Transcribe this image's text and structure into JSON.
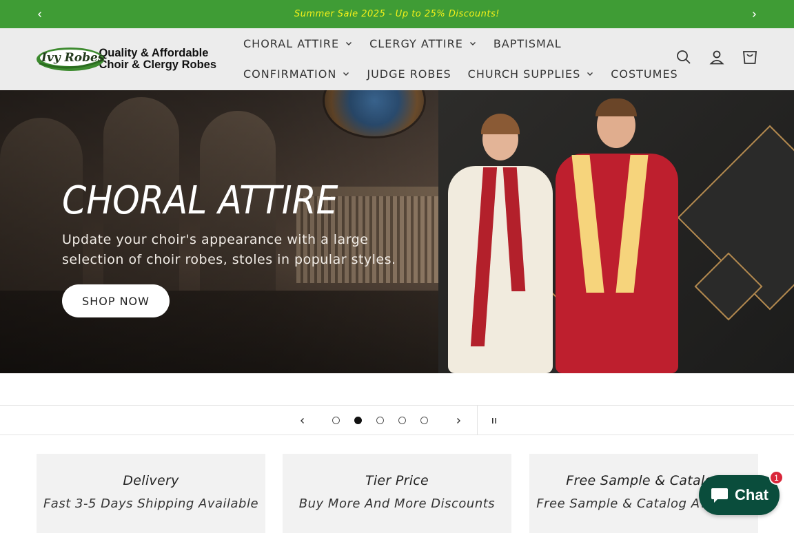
{
  "announcement": {
    "text": "Summer Sale 2025 - Up to 25% Discounts!",
    "prev_icon": "chevron-left-icon",
    "next_icon": "chevron-right-icon",
    "bg_color": "#3f9c35",
    "text_color": "#f3f11a"
  },
  "header": {
    "logo": {
      "script_text": "Ivy Robes",
      "tagline_line1": "Quality & Affordable",
      "tagline_line2": "Choir & Clergy Robes"
    },
    "nav_row1": [
      {
        "label": "CHORAL ATTIRE",
        "has_dropdown": true
      },
      {
        "label": "CLERGY ATTIRE",
        "has_dropdown": true
      },
      {
        "label": "BAPTISMAL",
        "has_dropdown": false
      }
    ],
    "nav_row2": [
      {
        "label": "CONFIRMATION",
        "has_dropdown": true
      },
      {
        "label": "JUDGE ROBES",
        "has_dropdown": false
      },
      {
        "label": "CHURCH SUPPLIES",
        "has_dropdown": true
      },
      {
        "label": "COSTUMES",
        "has_dropdown": false
      }
    ],
    "icons": [
      "search-icon",
      "account-icon",
      "cart-icon"
    ]
  },
  "hero": {
    "title": "CHORAL ATTIRE",
    "description": "Update your choir's appearance with a large selection of choir robes, stoles in popular styles.",
    "button_label": "SHOP NOW"
  },
  "slider": {
    "slide_count": 5,
    "active_index": 1
  },
  "features": [
    {
      "title": "Delivery",
      "subtitle": "Fast 3-5 Days Shipping Available"
    },
    {
      "title": "Tier Price",
      "subtitle": "Buy More And More Discounts"
    },
    {
      "title": "Free Sample & Catalog",
      "subtitle": "Free Sample & Catalog Available"
    }
  ],
  "chat": {
    "label": "Chat",
    "badge": "1",
    "color": "#0a4d3c"
  }
}
